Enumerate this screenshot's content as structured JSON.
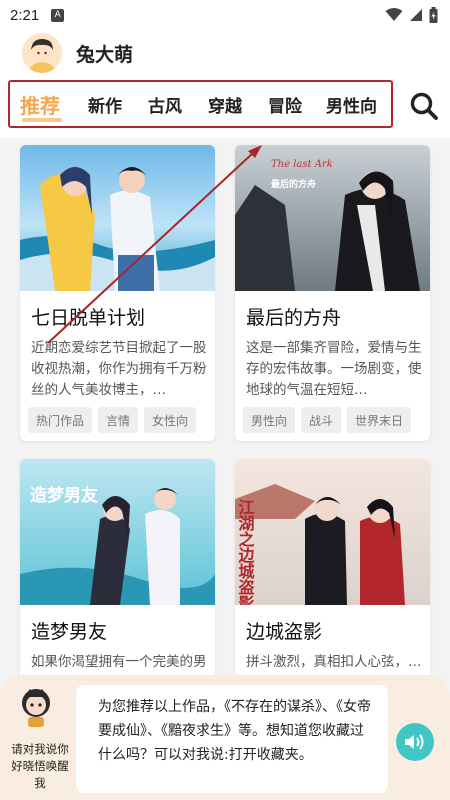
{
  "status_bar": {
    "time": "2:21",
    "notice_letter": "A"
  },
  "header": {
    "username": "兔大萌"
  },
  "tabs": [
    {
      "label": "推荐",
      "active": true
    },
    {
      "label": "新作"
    },
    {
      "label": "古风"
    },
    {
      "label": "穿越"
    },
    {
      "label": "冒险"
    },
    {
      "label": "男性向"
    }
  ],
  "accent_colors": {
    "active_tab": "#f5a74b",
    "highlight_box": "#b1272b",
    "speaker": "#3ec7c5",
    "assistant_bg": "#f8ede0"
  },
  "cards": [
    {
      "title": "七日脱单计划",
      "desc": "近期恋爱综艺节目掀起了一股收视热潮，你作为拥有千万粉丝的人气美妆博主，…",
      "tags": [
        "热门作品",
        "言情",
        "女性向"
      ]
    },
    {
      "title": "最后的方舟",
      "cover_text": "The last Ark",
      "cover_subtitle": "最后的方舟",
      "desc": "这是一部集齐冒险，爱情与生存的宏伟故事。一场剧变，使地球的气温在短短…",
      "tags": [
        "男性向",
        "战斗",
        "世界末日"
      ]
    },
    {
      "title": "造梦男友",
      "cover_text": "造梦男友",
      "desc": "如果你渴望拥有一个完美的男友…"
    },
    {
      "title": "边城盗影",
      "cover_text": "江湖之边城盗影",
      "desc": "拼斗激烈，真相扣人心弦，…"
    }
  ],
  "assistant": {
    "label": "请对我说你好晓悟唤醒我",
    "message": "为您推荐以上作品，《不存在的谋杀》、《女帝要成仙》、《黯夜求生》等。想知道您收藏过什么吗？可以对我说:打开收藏夹。"
  }
}
